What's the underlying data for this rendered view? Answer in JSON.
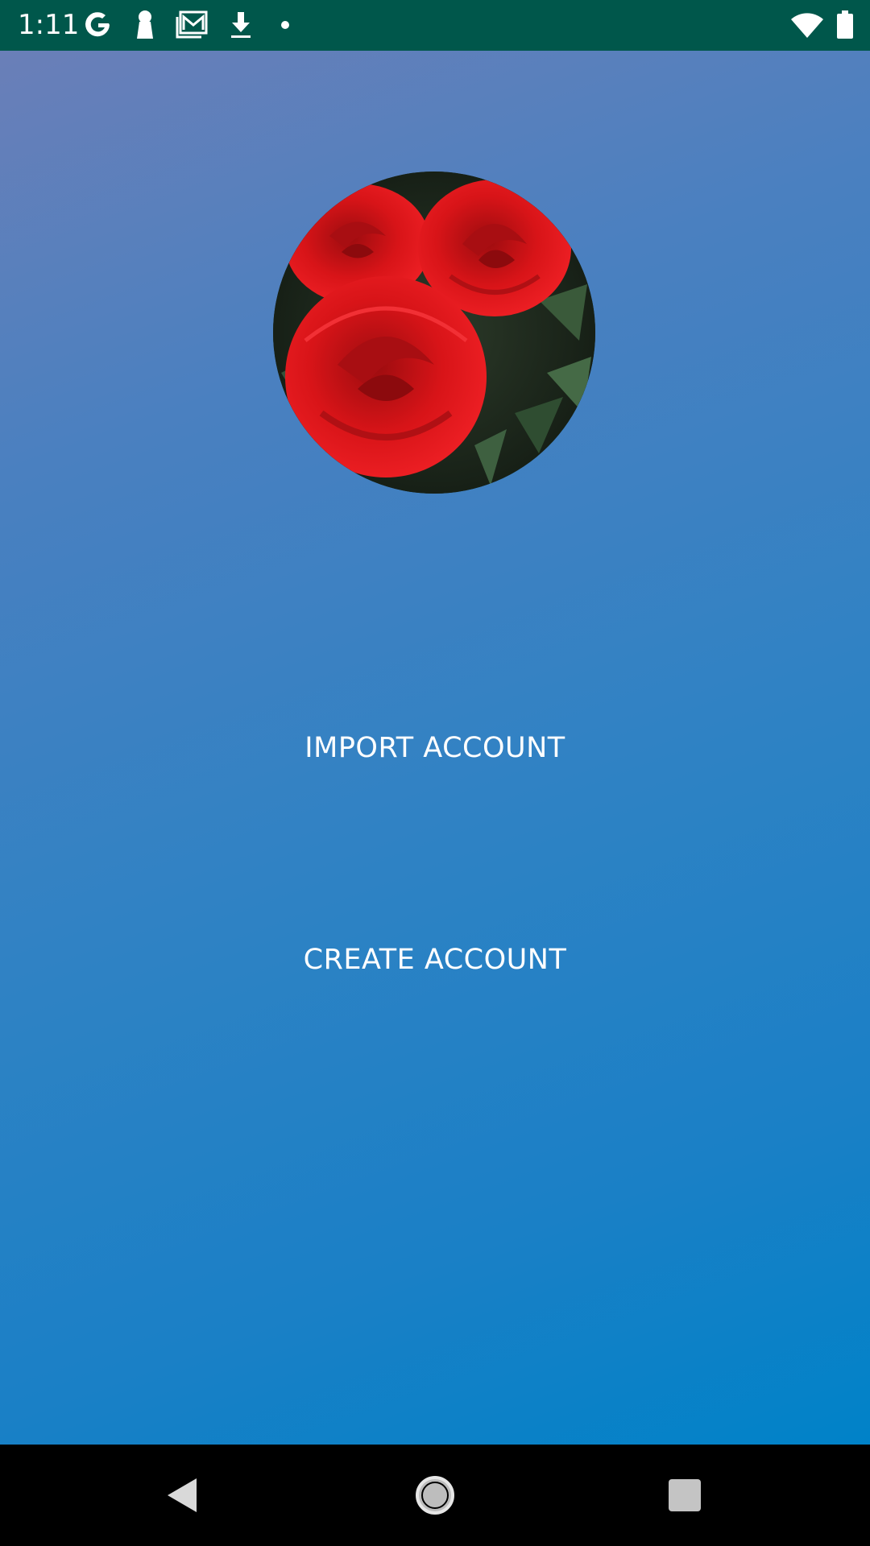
{
  "status_bar": {
    "time": "1:11",
    "icons": [
      "google-icon",
      "keyhole-icon",
      "mail-icon",
      "download-icon",
      "dot-icon",
      "wifi-icon",
      "battery-icon"
    ],
    "background": "#00574b"
  },
  "main": {
    "avatar": {
      "icon": "rose-avatar-image"
    },
    "import_label": "IMPORT ACCOUNT",
    "create_label": "CREATE ACCOUNT",
    "gradient_start": "#6a7fb8",
    "gradient_end": "#0082c8"
  },
  "nav_bar": {
    "icons": [
      "back-icon",
      "home-icon",
      "recents-icon"
    ]
  }
}
